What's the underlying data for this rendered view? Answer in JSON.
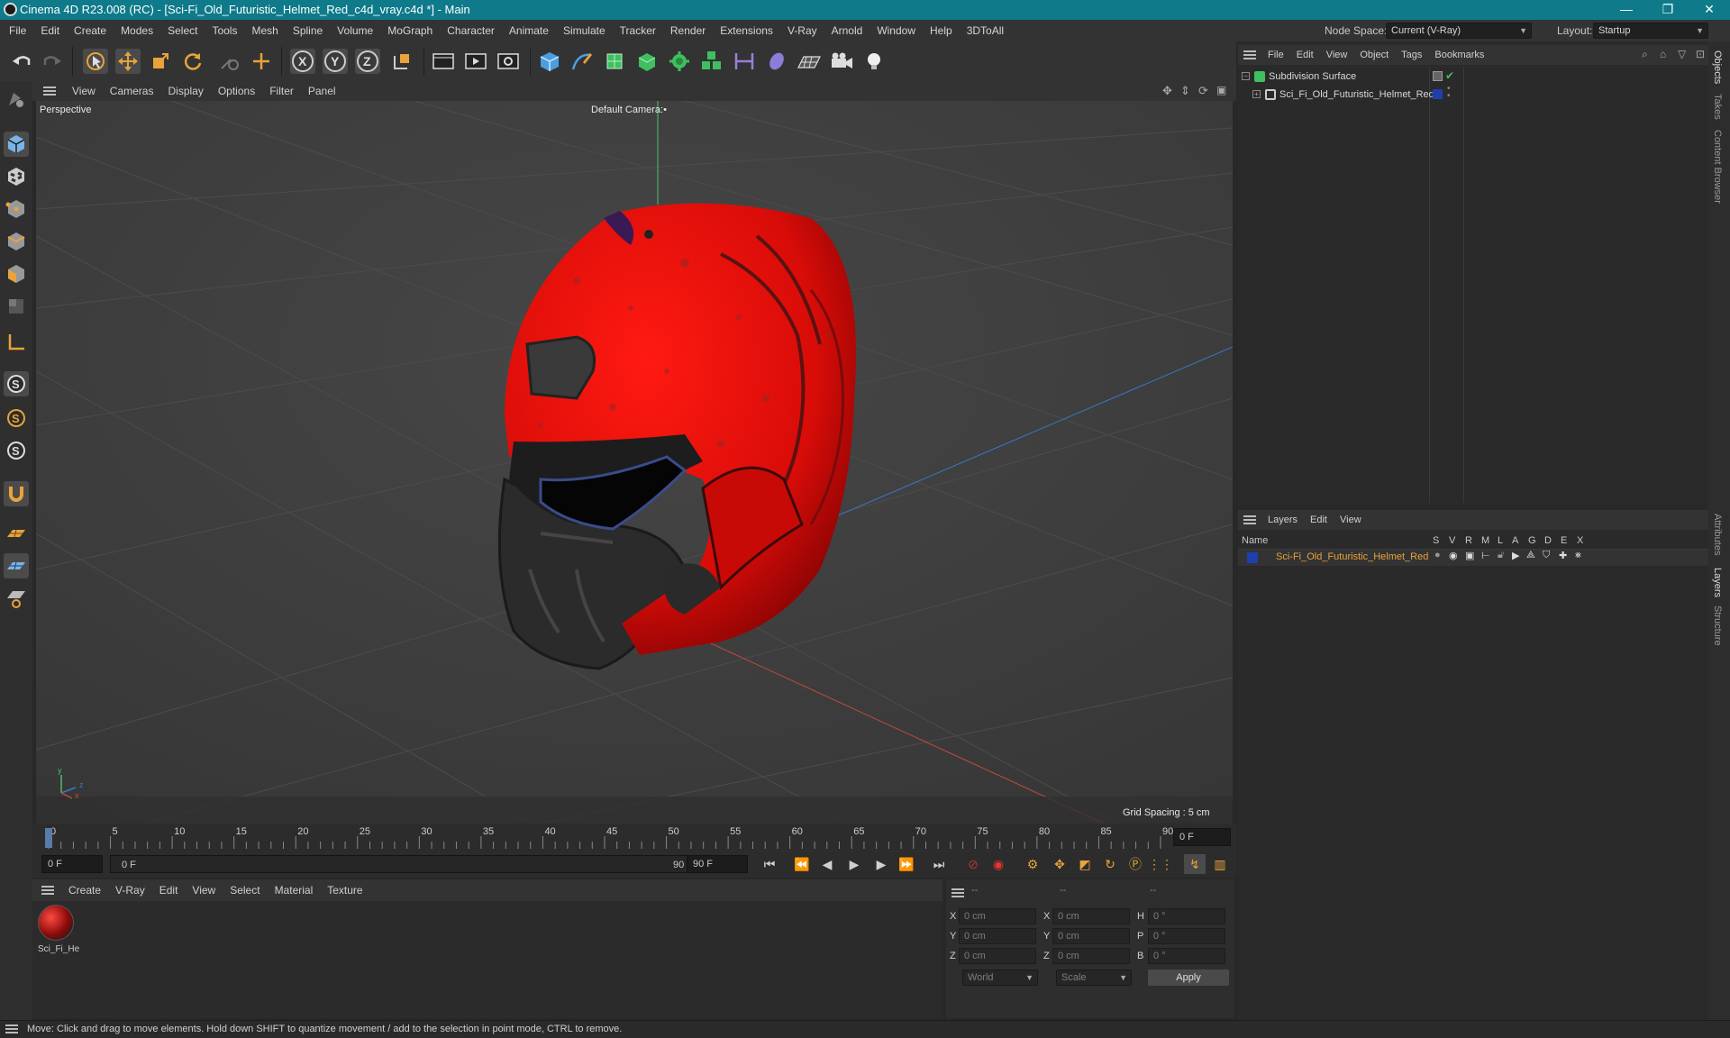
{
  "window": {
    "title": "Cinema 4D R23.008 (RC) - [Sci-Fi_Old_Futuristic_Helmet_Red_c4d_vray.c4d *] - Main",
    "minimize": "—",
    "restore": "❐",
    "close": "✕"
  },
  "menubar": {
    "items": [
      "File",
      "Edit",
      "Create",
      "Modes",
      "Select",
      "Tools",
      "Mesh",
      "Spline",
      "Volume",
      "MoGraph",
      "Character",
      "Animate",
      "Simulate",
      "Tracker",
      "Render",
      "Extensions",
      "V-Ray",
      "Arnold",
      "Window",
      "Help",
      "3DToAll"
    ],
    "node_space_label": "Node Space:",
    "node_space_value": "Current (V-Ray)",
    "layout_label": "Layout:",
    "layout_value": "Startup"
  },
  "viewport": {
    "menu": [
      "View",
      "Cameras",
      "Display",
      "Options",
      "Filter",
      "Panel"
    ],
    "view_name": "Perspective",
    "camera": "Default Camera",
    "camera_mark": ":•",
    "grid_spacing": "Grid Spacing : 5 cm",
    "axis_y": "y",
    "axis_z": "z",
    "axis_x": "x"
  },
  "timeline": {
    "ticks": [
      "0",
      "5",
      "10",
      "15",
      "20",
      "25",
      "30",
      "35",
      "40",
      "45",
      "50",
      "55",
      "60",
      "65",
      "70",
      "75",
      "80",
      "85",
      "90"
    ],
    "current_frame": "0 F",
    "start_field": "0 F",
    "range_start": "0 F",
    "range_end": "90 F",
    "end_field": "90 F"
  },
  "material_manager": {
    "menu": [
      "Create",
      "V-Ray",
      "Edit",
      "View",
      "Select",
      "Material",
      "Texture"
    ],
    "materials": [
      {
        "name": "Sci_Fi_He"
      }
    ]
  },
  "coordinates": {
    "header": [
      "--",
      "--",
      "--"
    ],
    "rows": [
      {
        "axis": "X",
        "pos": "0 cm",
        "axis2": "X",
        "size": "0 cm",
        "rot_axis": "H",
        "rot": "0 °"
      },
      {
        "axis": "Y",
        "pos": "0 cm",
        "axis2": "Y",
        "size": "0 cm",
        "rot_axis": "P",
        "rot": "0 °"
      },
      {
        "axis": "Z",
        "pos": "0 cm",
        "axis2": "Z",
        "size": "0 cm",
        "rot_axis": "B",
        "rot": "0 °"
      }
    ],
    "mode": "World",
    "transform": "Scale",
    "apply_label": "Apply"
  },
  "object_manager": {
    "menu": [
      "File",
      "Edit",
      "View",
      "Object",
      "Tags",
      "Bookmarks"
    ],
    "objects": [
      {
        "name": "Subdivision Surface",
        "icon": "subdivision-icon"
      },
      {
        "name": "Sci_Fi_Old_Futuristic_Helmet_Red",
        "icon": "null-object-icon"
      }
    ]
  },
  "layer_manager": {
    "menu": [
      "Layers",
      "Edit",
      "View"
    ],
    "columns": [
      "Name",
      "S",
      "V",
      "R",
      "M",
      "L",
      "A",
      "G",
      "D",
      "E",
      "X"
    ],
    "layers": [
      {
        "name": "Sci-Fi_Old_Futuristic_Helmet_Red",
        "color": "#1f3fb0"
      }
    ]
  },
  "side_tabs": [
    "Objects",
    "Takes",
    "Content Browser",
    "Attributes",
    "Layers",
    "Structure"
  ],
  "status": "Move: Click and drag to move elements. Hold down SHIFT to quantize movement / add to the selection in point mode, CTRL to remove.",
  "colors": {
    "accent": "#0e7a8a",
    "orange": "#e8a33a",
    "layer_text": "#e8a33a"
  }
}
